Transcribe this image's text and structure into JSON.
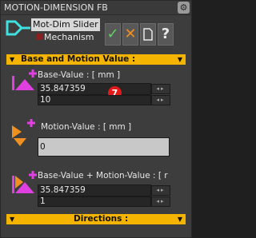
{
  "window": {
    "title": "MOTION-DIMENSION FB"
  },
  "mode": {
    "selected": "Mot-Dim Slider",
    "option": "Mechanism"
  },
  "toolbar": {
    "ok": "✓",
    "cancel": "✕",
    "help": "?"
  },
  "sections": [
    {
      "label": "Base and Motion Value :"
    },
    {
      "label": "Directions :"
    }
  ],
  "base": {
    "label": "Base-Value : [ mm ]",
    "value": "35.847359",
    "step": "10",
    "badge": "7"
  },
  "motion": {
    "label": "Motion-Value : [ mm ]",
    "value": "0"
  },
  "sum": {
    "label": "Base-Value + Motion-Value : [ r",
    "value": "35.847359",
    "step": "1"
  },
  "colors": {
    "accent": "#f5b400",
    "icon_magenta": "#e040e0",
    "icon_orange": "#f09020",
    "badge": "#e21a1a"
  }
}
